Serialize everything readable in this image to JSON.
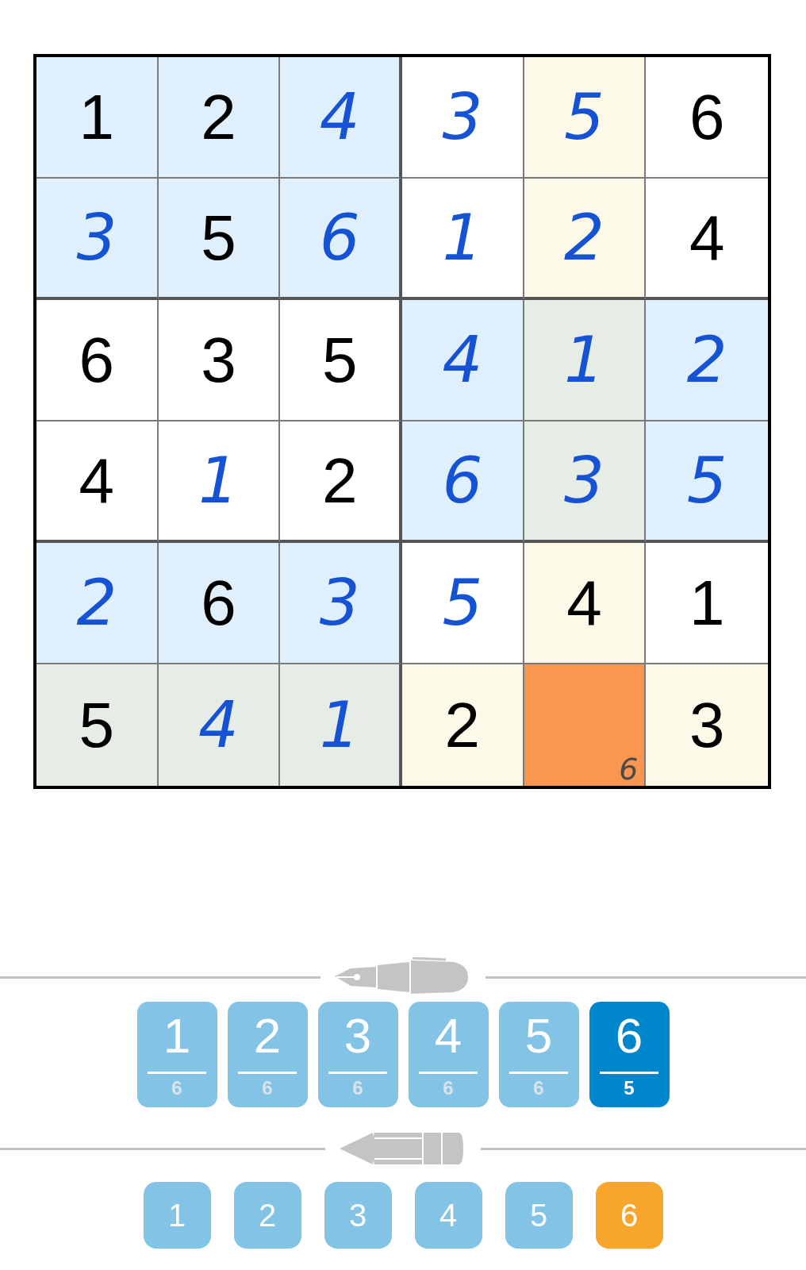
{
  "grid": {
    "rows": [
      {
        "cells": [
          {
            "value": "1",
            "kind": "given",
            "color": "#dff0fc"
          },
          {
            "value": "2",
            "kind": "given",
            "color": "#dff0fc"
          },
          {
            "value": "4",
            "kind": "entered",
            "color": "#dff0fc"
          },
          {
            "value": "3",
            "kind": "entered",
            "color": "#ffffff"
          },
          {
            "value": "5",
            "kind": "entered",
            "color": "#fdf9e9"
          },
          {
            "value": "6",
            "kind": "given",
            "color": "#ffffff"
          }
        ]
      },
      {
        "cells": [
          {
            "value": "3",
            "kind": "entered",
            "color": "#dff0fc"
          },
          {
            "value": "5",
            "kind": "given",
            "color": "#dff0fc"
          },
          {
            "value": "6",
            "kind": "entered",
            "color": "#dff0fc"
          },
          {
            "value": "1",
            "kind": "entered",
            "color": "#ffffff"
          },
          {
            "value": "2",
            "kind": "entered",
            "color": "#fdf9e9"
          },
          {
            "value": "4",
            "kind": "given",
            "color": "#ffffff"
          }
        ]
      },
      {
        "cells": [
          {
            "value": "6",
            "kind": "given",
            "color": "#ffffff"
          },
          {
            "value": "3",
            "kind": "given",
            "color": "#ffffff"
          },
          {
            "value": "5",
            "kind": "given",
            "color": "#ffffff"
          },
          {
            "value": "4",
            "kind": "entered",
            "color": "#dff0fc"
          },
          {
            "value": "1",
            "kind": "entered",
            "color": "#e6ece6"
          },
          {
            "value": "2",
            "kind": "entered",
            "color": "#dff0fc"
          }
        ]
      },
      {
        "cells": [
          {
            "value": "4",
            "kind": "given",
            "color": "#ffffff"
          },
          {
            "value": "1",
            "kind": "entered",
            "color": "#ffffff"
          },
          {
            "value": "2",
            "kind": "given",
            "color": "#ffffff"
          },
          {
            "value": "6",
            "kind": "entered",
            "color": "#dff0fc"
          },
          {
            "value": "3",
            "kind": "entered",
            "color": "#e6ece6"
          },
          {
            "value": "5",
            "kind": "entered",
            "color": "#dff0fc"
          }
        ]
      },
      {
        "cells": [
          {
            "value": "2",
            "kind": "entered",
            "color": "#dff0fc"
          },
          {
            "value": "6",
            "kind": "given",
            "color": "#dff0fc"
          },
          {
            "value": "3",
            "kind": "entered",
            "color": "#dff0fc"
          },
          {
            "value": "5",
            "kind": "entered",
            "color": "#ffffff"
          },
          {
            "value": "4",
            "kind": "given",
            "color": "#fdf9e9"
          },
          {
            "value": "1",
            "kind": "given",
            "color": "#ffffff"
          }
        ]
      },
      {
        "cells": [
          {
            "value": "5",
            "kind": "given",
            "color": "#e6ece6"
          },
          {
            "value": "4",
            "kind": "entered",
            "color": "#e6ece6"
          },
          {
            "value": "1",
            "kind": "entered",
            "color": "#e6ece6"
          },
          {
            "value": "2",
            "kind": "given",
            "color": "#fdf9e9"
          },
          {
            "kind": "empty",
            "color": "#f9964f",
            "notes": [
              "6"
            ]
          },
          {
            "value": "3",
            "kind": "given",
            "color": "#fdf9e9"
          }
        ]
      }
    ]
  },
  "pen_keys": [
    {
      "digit": "1",
      "count": "6",
      "selected": false
    },
    {
      "digit": "2",
      "count": "6",
      "selected": false
    },
    {
      "digit": "3",
      "count": "6",
      "selected": false
    },
    {
      "digit": "4",
      "count": "6",
      "selected": false
    },
    {
      "digit": "5",
      "count": "6",
      "selected": false
    },
    {
      "digit": "6",
      "count": "5",
      "selected": true
    }
  ],
  "pencil_keys": [
    {
      "digit": "1",
      "selected": false
    },
    {
      "digit": "2",
      "selected": false
    },
    {
      "digit": "3",
      "selected": false
    },
    {
      "digit": "4",
      "selected": false
    },
    {
      "digit": "5",
      "selected": false
    },
    {
      "digit": "6",
      "selected": true
    }
  ]
}
